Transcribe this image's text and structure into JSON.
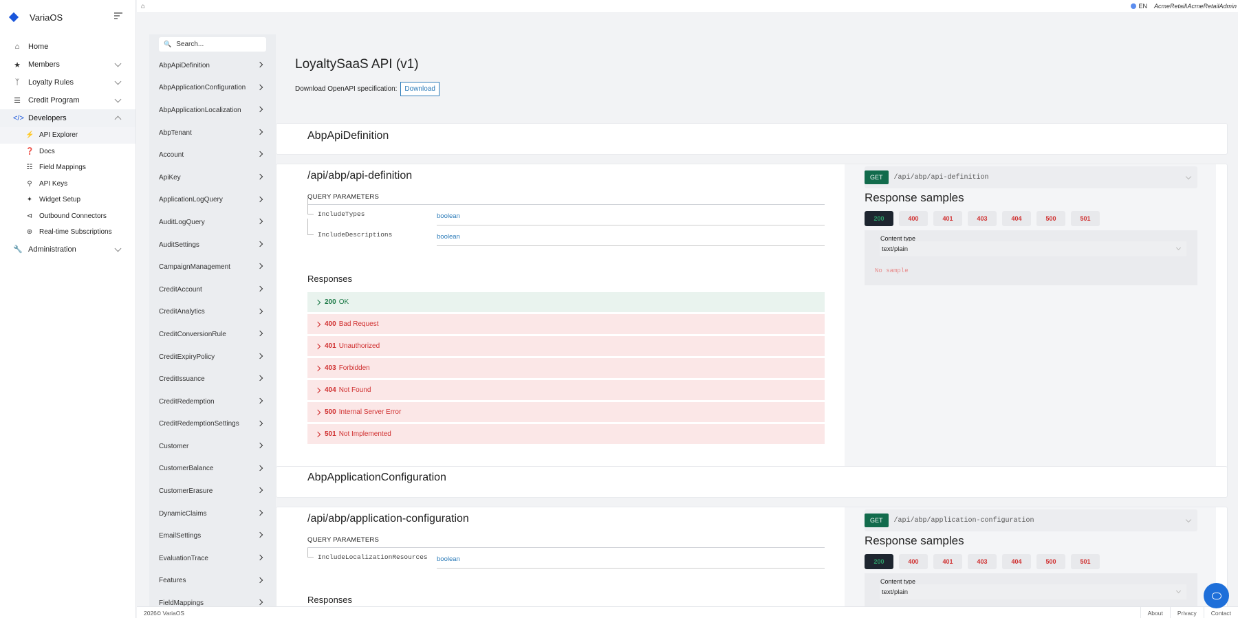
{
  "app": {
    "name": "VariaOS"
  },
  "topbar": {
    "language": "EN",
    "tenant": "AcmeRetail\\AcmeRetailAdmin"
  },
  "sidebar": {
    "items": [
      {
        "label": "Home",
        "icon": "home-icon"
      },
      {
        "label": "Members",
        "icon": "star-icon"
      },
      {
        "label": "Loyalty Rules",
        "icon": "branch-icon"
      },
      {
        "label": "Credit Program",
        "icon": "coins-icon"
      },
      {
        "label": "Developers",
        "icon": "code-icon"
      }
    ],
    "developers_children": [
      {
        "label": "API Explorer",
        "icon": "plug-icon"
      },
      {
        "label": "Docs",
        "icon": "question-icon"
      },
      {
        "label": "Field Mappings",
        "icon": "sliders-icon"
      },
      {
        "label": "API Keys",
        "icon": "key-icon"
      },
      {
        "label": "Widget Setup",
        "icon": "puzzle-icon"
      },
      {
        "label": "Outbound Connectors",
        "icon": "share-icon"
      },
      {
        "label": "Real-time Subscriptions",
        "icon": "broadcast-icon"
      }
    ],
    "administration": {
      "label": "Administration",
      "icon": "wrench-icon"
    }
  },
  "api_nav": {
    "search_placeholder": "Search...",
    "items": [
      "AbpApiDefinition",
      "AbpApplicationConfiguration",
      "AbpApplicationLocalization",
      "AbpTenant",
      "Account",
      "ApiKey",
      "ApplicationLogQuery",
      "AuditLogQuery",
      "AuditSettings",
      "CampaignManagement",
      "CreditAccount",
      "CreditAnalytics",
      "CreditConversionRule",
      "CreditExpiryPolicy",
      "CreditIssuance",
      "CreditRedemption",
      "CreditRedemptionSettings",
      "Customer",
      "CustomerBalance",
      "CustomerErasure",
      "DynamicClaims",
      "EmailSettings",
      "EvaluationTrace",
      "Features",
      "FieldMappings"
    ]
  },
  "main": {
    "title": "LoyaltySaaS API (v1)",
    "download_label": "Download OpenAPI specification:",
    "download_button": "Download",
    "groups": [
      {
        "name": "AbpApiDefinition"
      },
      {
        "name": "AbpApplicationConfiguration"
      }
    ],
    "operations": [
      {
        "path": "/api/abp/api-definition",
        "query_header": "QUERY PARAMETERS",
        "params": [
          {
            "name": "IncludeTypes",
            "type": "boolean"
          },
          {
            "name": "IncludeDescriptions",
            "type": "boolean"
          }
        ],
        "responses_title": "Responses",
        "responses": [
          {
            "code": "200",
            "text": "OK",
            "kind": "ok"
          },
          {
            "code": "400",
            "text": "Bad Request",
            "kind": "err"
          },
          {
            "code": "401",
            "text": "Unauthorized",
            "kind": "err"
          },
          {
            "code": "403",
            "text": "Forbidden",
            "kind": "err"
          },
          {
            "code": "404",
            "text": "Not Found",
            "kind": "err"
          },
          {
            "code": "500",
            "text": "Internal Server Error",
            "kind": "err"
          },
          {
            "code": "501",
            "text": "Not Implemented",
            "kind": "err"
          }
        ],
        "method": "GET",
        "samples_title": "Response samples",
        "sample_tabs": [
          "200",
          "400",
          "401",
          "403",
          "404",
          "500",
          "501"
        ],
        "content_type_label": "Content type",
        "content_type": "text/plain",
        "no_sample": "No sample"
      },
      {
        "path": "/api/abp/application-configuration",
        "query_header": "QUERY PARAMETERS",
        "params": [
          {
            "name": "IncludeLocalizationResources",
            "type": "boolean"
          }
        ],
        "responses_title": "Responses",
        "method": "GET",
        "samples_title": "Response samples",
        "sample_tabs": [
          "200",
          "400",
          "401",
          "403",
          "404",
          "500",
          "501"
        ],
        "content_type_label": "Content type",
        "content_type": "text/plain"
      }
    ]
  },
  "footer": {
    "copyright": "2026© VariaOS",
    "links": [
      "About",
      "Privacy",
      "Contact"
    ]
  },
  "colors": {
    "accent": "#1a56db",
    "ok": "#1d7a47",
    "error": "#d03030",
    "get_badge": "#126b4c"
  }
}
